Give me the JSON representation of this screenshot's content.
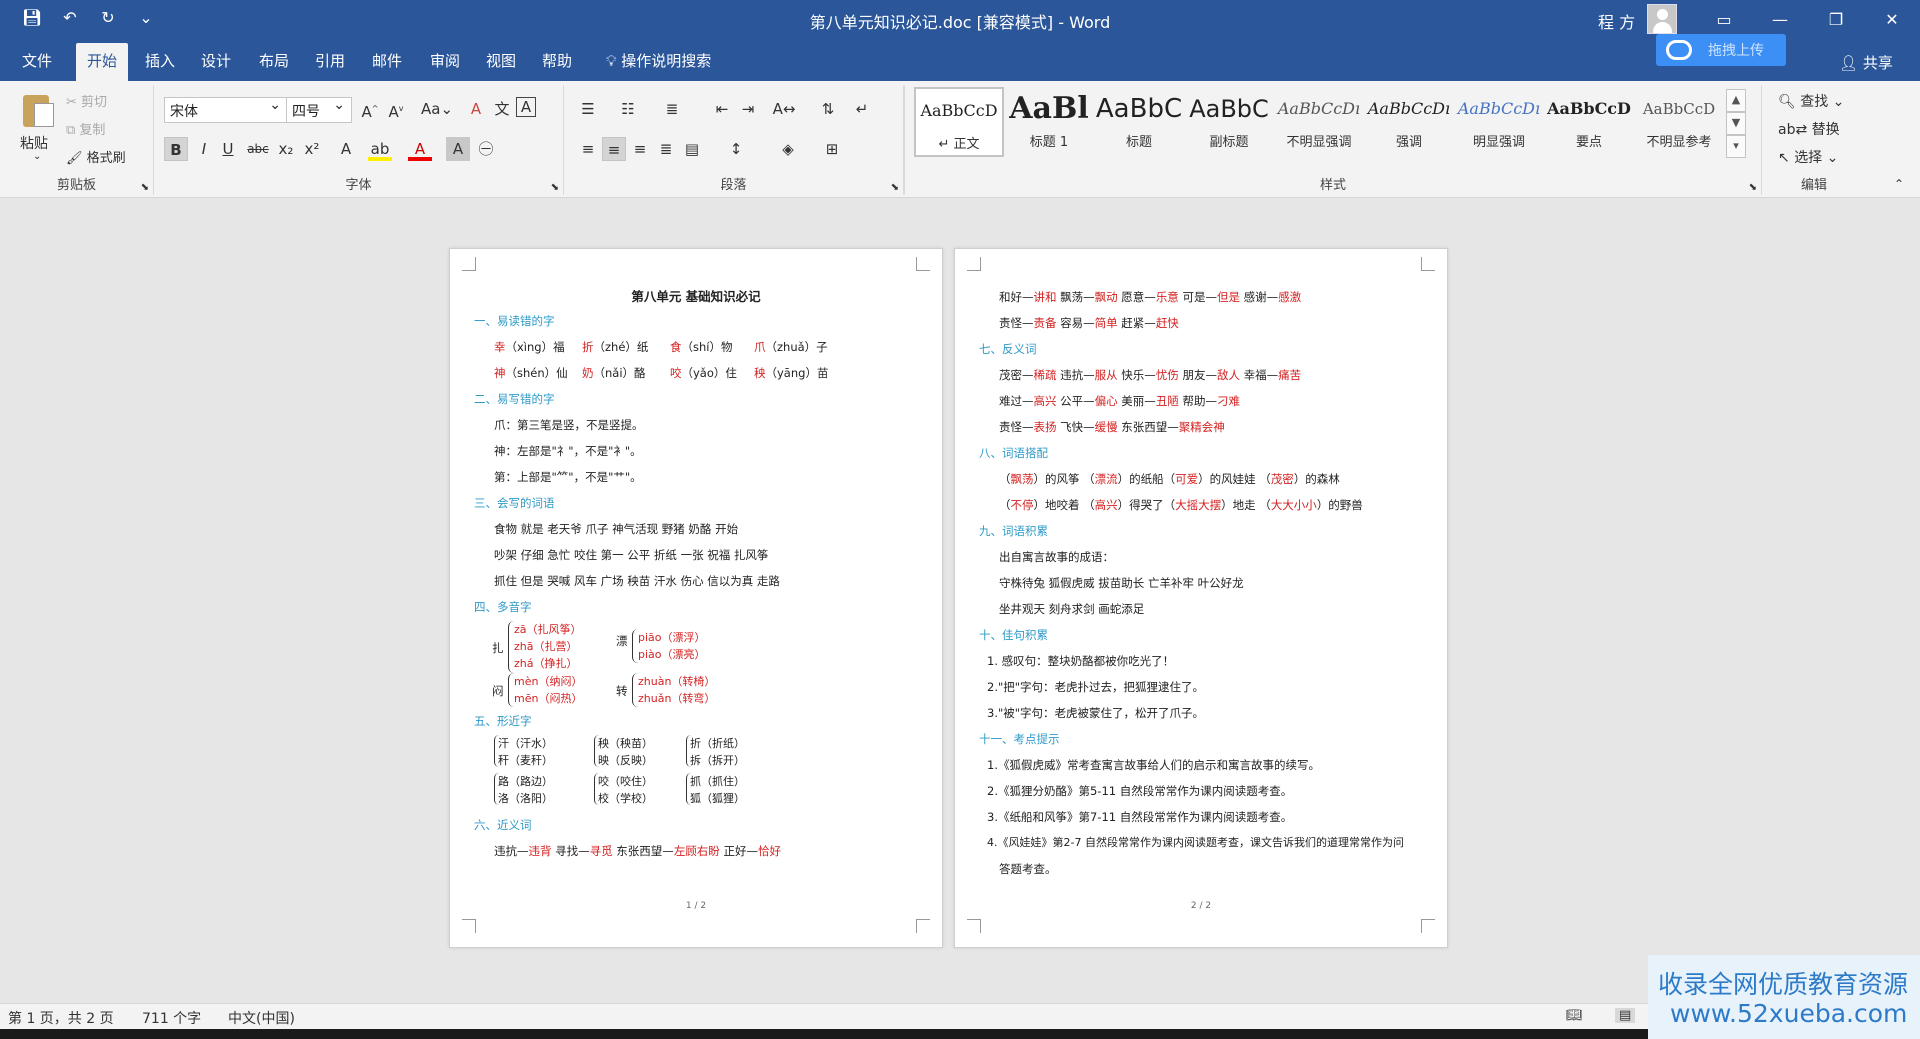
{
  "window": {
    "title": "第八单元知识必记.doc [兼容模式]  -  Word",
    "user": "程 方"
  },
  "tabs": [
    "文件",
    "开始",
    "插入",
    "设计",
    "布局",
    "引用",
    "邮件",
    "审阅",
    "视图",
    "帮助"
  ],
  "tellme": "操作说明搜索",
  "share": "共享",
  "baidu": {
    "label": "拖拽上传"
  },
  "ribbon": {
    "clipboard": {
      "label": "剪贴板",
      "paste": "粘贴",
      "cut": "剪切",
      "copy": "复制",
      "format_painter": "格式刷"
    },
    "font": {
      "label": "字体",
      "name": "宋体",
      "size": "四号"
    },
    "paragraph": {
      "label": "段落"
    },
    "styles": {
      "label": "样式",
      "items": [
        {
          "preview": "AaBbCcD",
          "name": "↵ 正文"
        },
        {
          "preview": "AaBl",
          "name": "标题 1"
        },
        {
          "preview": "AaBbC",
          "name": "标题"
        },
        {
          "preview": "AaBbC",
          "name": "副标题"
        },
        {
          "preview": "AaBbCcDı",
          "name": "不明显强调"
        },
        {
          "preview": "AaBbCcDı",
          "name": "强调"
        },
        {
          "preview": "AaBbCcDı",
          "name": "明显强调"
        },
        {
          "preview": "AaBbCcD",
          "name": "要点"
        },
        {
          "preview": "AaBbCcD",
          "name": "不明显参考"
        }
      ]
    },
    "editing": {
      "label": "编辑",
      "find": "查找",
      "replace": "替换",
      "select": "选择"
    }
  },
  "page1": {
    "title": "第八单元  基础知识必记",
    "h1": "一、易读错的字",
    "r1": [
      {
        "c": "幸",
        "p": "（xìng）福"
      },
      {
        "c": "折",
        "p": "（zhé）纸"
      },
      {
        "c": "食",
        "p": "（shí）物"
      },
      {
        "c": "爪",
        "p": "（zhuǎ）子"
      }
    ],
    "r2": [
      {
        "c": "神",
        "p": "（shén）仙"
      },
      {
        "c": "奶",
        "p": "（nǎi）酪"
      },
      {
        "c": "咬",
        "p": "（yǎo）住"
      },
      {
        "c": "秧",
        "p": "（yāng）苗"
      }
    ],
    "h2": "二、易写错的字",
    "l1": "爪：第三笔是竖，不是竖提。",
    "l2": "神：左部是\"礻\"，不是\"衤\"。",
    "l3": "第：上部是\"⺮\"，不是\"艹\"。",
    "h3": "三、会写的词语",
    "w1": "食物  就是  老天爷  爪子  神气活现  野猪  奶酪  开始",
    "w2": "吵架  仔细  急忙  咬住  第一  公平  折纸  一张  祝福  扎风筝",
    "w3": "抓住  但是  哭喊  风车  广场  秧苗  汗水  伤心  信以为真  走路",
    "h4": "四、多音字",
    "poly1": {
      "c": "扎",
      "a": [
        "zā（扎风筝）",
        "zhā（扎营）",
        "zhá（挣扎）"
      ]
    },
    "poly2": {
      "c": "漂",
      "a": [
        "piāo（漂浮）",
        "piào（漂亮）"
      ]
    },
    "poly3": {
      "c": "闷",
      "a": [
        "mèn（纳闷）",
        "mēn（闷热）"
      ]
    },
    "poly4": {
      "c": "转",
      "a": [
        "zhuàn（转椅）",
        "zhuǎn（转弯）"
      ]
    },
    "h5": "五、形近字",
    "sim": [
      [
        "汗（汗水）",
        "秧（秧苗）",
        "折（折纸）"
      ],
      [
        "秆（麦秆）",
        "映（反映）",
        "拆（拆开）"
      ],
      [
        "路（路边）",
        "咬（咬住）",
        "抓（抓住）"
      ],
      [
        "洛（洛阳）",
        "校（学校）",
        "狐（狐狸）"
      ]
    ],
    "h6": "六、近义词",
    "syn": [
      {
        "a": "违抗—",
        "b": "违背"
      },
      {
        "a": "  寻找—",
        "b": "寻觅"
      },
      {
        "a": "  东张西望—",
        "b": "左顾右盼"
      },
      {
        "a": "  正好—",
        "b": "恰好"
      }
    ],
    "num": "1 / 2"
  },
  "page2": {
    "s1": [
      {
        "a": "和好—",
        "b": "讲和"
      },
      {
        "a": "  飘荡—",
        "b": "飘动"
      },
      {
        "a": "  愿意—",
        "b": "乐意"
      },
      {
        "a": "  可是—",
        "b": "但是"
      },
      {
        "a": "  感谢—",
        "b": "感激"
      }
    ],
    "s2": [
      {
        "a": "责怪—",
        "b": "责备"
      },
      {
        "a": "  容易—",
        "b": "简单"
      },
      {
        "a": "  赶紧—",
        "b": "赶快"
      }
    ],
    "h7": "七、反义词",
    "a1": [
      {
        "a": "茂密—",
        "b": "稀疏"
      },
      {
        "a": "  违抗—",
        "b": "服从"
      },
      {
        "a": "  快乐—",
        "b": "忧伤"
      },
      {
        "a": "  朋友—",
        "b": "敌人"
      },
      {
        "a": "  幸福—",
        "b": "痛苦"
      }
    ],
    "a2": [
      {
        "a": "难过—",
        "b": "高兴"
      },
      {
        "a": "  公平—",
        "b": "偏心"
      },
      {
        "a": "  美丽—",
        "b": "丑陋"
      },
      {
        "a": "  帮助—",
        "b": "刁难"
      }
    ],
    "a3": [
      {
        "a": "责怪—",
        "b": "表扬"
      },
      {
        "a": "  飞快—",
        "b": "缓慢"
      },
      {
        "a": "  东张西望—",
        "b": "聚精会神"
      }
    ],
    "h8": "八、词语搭配",
    "m1": [
      {
        "a": "（",
        "b": "飘荡"
      },
      {
        "a": "）的风筝  （",
        "b": "漂流"
      },
      {
        "a": "）的纸船（",
        "b": "可爱"
      },
      {
        "a": "）的风娃娃  （",
        "b": "茂密"
      },
      {
        "a": "）的森林",
        "b": ""
      }
    ],
    "m2": [
      {
        "a": "（",
        "b": "不停"
      },
      {
        "a": "）地咬着  （",
        "b": "高兴"
      },
      {
        "a": "）得哭了（",
        "b": "大摇大摆"
      },
      {
        "a": "）地走  （",
        "b": "大大小小"
      },
      {
        "a": "）的野兽",
        "b": ""
      }
    ],
    "h9": "九、词语积累",
    "i1": "出自寓言故事的成语：",
    "i2": "守株待兔  狐假虎威  拔苗助长  亡羊补牢  叶公好龙",
    "i3": "坐井观天  刻舟求剑  画蛇添足",
    "h10": "十、佳句积累",
    "j1": "1. 感叹句：整块奶酪都被你吃光了！",
    "j2": "2.\"把\"字句：老虎扑过去，把狐狸逮住了。",
    "j3": "3.\"被\"字句：老虎被蒙住了，松开了爪子。",
    "h11": "十一、考点提示",
    "k1": "1.《狐假虎威》常考查寓言故事给人们的启示和寓言故事的续写。",
    "k2": "2.《狐狸分奶酪》第5-11 自然段常常作为课内阅读题考查。",
    "k3": "3.《纸船和风筝》第7-11 自然段常常作为课内阅读题考查。",
    "k4": "4.《风娃娃》第2-7 自然段常常作为课内阅读题考查，课文告诉我们的道理常常作为问",
    "k5": "答题考查。",
    "num": "2 / 2"
  },
  "status": {
    "page": "第 1 页，共 2 页",
    "words": "711 个字",
    "lang": "中文(中国)"
  },
  "watermark": {
    "line1": "收录全网优质教育资源",
    "line2": "www.52xueba.com"
  }
}
